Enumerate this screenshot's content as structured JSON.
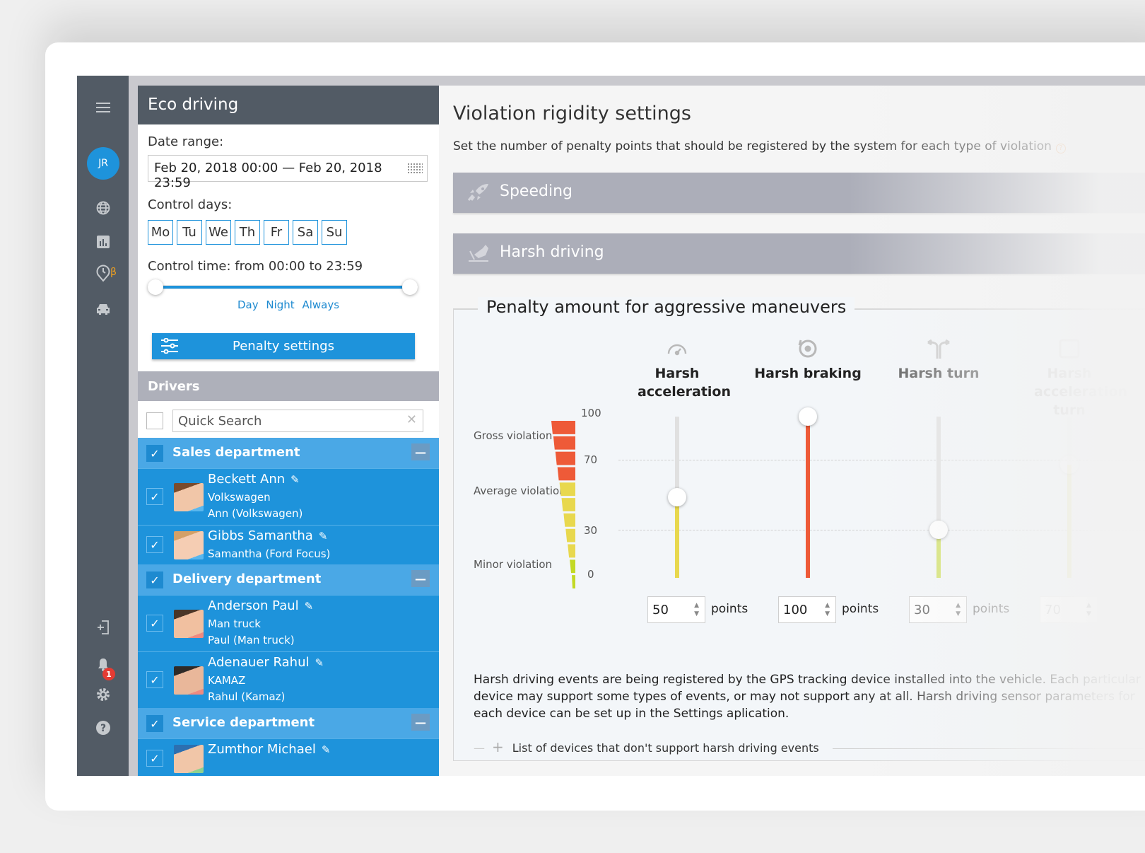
{
  "rail": {
    "avatar_initials": "JR",
    "beta_label": "β",
    "notification_count": "1",
    "icons": [
      "menu-icon",
      "globe-icon",
      "chart-icon",
      "clock-pin-icon",
      "car-icon",
      "logout-icon",
      "bell-icon",
      "gear-icon",
      "help-icon"
    ]
  },
  "panel": {
    "title": "Eco driving",
    "date_range_label": "Date range:",
    "date_range_value": "Feb 20, 2018 00:00 — Feb 20, 2018 23:59",
    "control_days_label": "Control days:",
    "days": [
      "Mo",
      "Tu",
      "We",
      "Th",
      "Fr",
      "Sa",
      "Su"
    ],
    "control_time_label": "Control time: from 00:00 to 23:59",
    "time_range": {
      "from": "00:00",
      "to": "23:59"
    },
    "presets": [
      "Day",
      "Night",
      "Always"
    ],
    "penalty_button": "Penalty settings",
    "drivers_header": "Drivers",
    "search_placeholder": "Quick Search",
    "groups": [
      {
        "name": "Sales department",
        "drivers": [
          {
            "name": "Beckett Ann",
            "lines": [
              "Volkswagen",
              "Ann (Volkswagen)"
            ]
          },
          {
            "name": "Gibbs Samantha",
            "lines": [
              "Samantha (Ford Focus)"
            ]
          }
        ]
      },
      {
        "name": "Delivery department",
        "drivers": [
          {
            "name": "Anderson Paul",
            "lines": [
              "Man truck",
              "Paul (Man truck)"
            ]
          },
          {
            "name": "Adenauer Rahul",
            "lines": [
              "KAMAZ",
              "Rahul (Kamaz)"
            ]
          }
        ]
      },
      {
        "name": "Service department",
        "drivers": [
          {
            "name": "Zumthor Michael",
            "lines": []
          }
        ]
      }
    ]
  },
  "main": {
    "title": "Violation rigidity settings",
    "description": "Set the number of penalty points that should be registered by the system for each type of violation",
    "sections": [
      "Speeding",
      "Harsh driving"
    ],
    "penalty_title": "Penalty amount for aggressive maneuvers",
    "zones": [
      "Gross violation",
      "Average violation",
      "Minor violation"
    ],
    "scale_ticks": [
      "100",
      "70",
      "30",
      "0"
    ],
    "maneuvers": [
      {
        "label": "Harsh acceleration",
        "value": "50",
        "percent": 50,
        "color": "#e8d84e"
      },
      {
        "label": "Harsh braking",
        "value": "100",
        "percent": 100,
        "color": "#ee5a38"
      },
      {
        "label": "Harsh turn",
        "value": "30",
        "percent": 30,
        "color": "#cfe05a"
      },
      {
        "label": "Harsh acceleration turn",
        "value": "70",
        "percent": 70,
        "color": "#e8e4b0"
      }
    ],
    "points_label": "points",
    "info_text": "Harsh driving events are being registered by the GPS tracking device installed into the vehicle. Each particular device may support some types of events, or may not support any at all. Harsh driving sensor parameters for each device can be set up in the Settings aplication.",
    "devices_link": "List of devices that don't support harsh driving events",
    "colors": {
      "accent": "#1e93db",
      "gross": "#ee5a38",
      "average": "#e8d84e",
      "minor": "#c3d925"
    }
  }
}
